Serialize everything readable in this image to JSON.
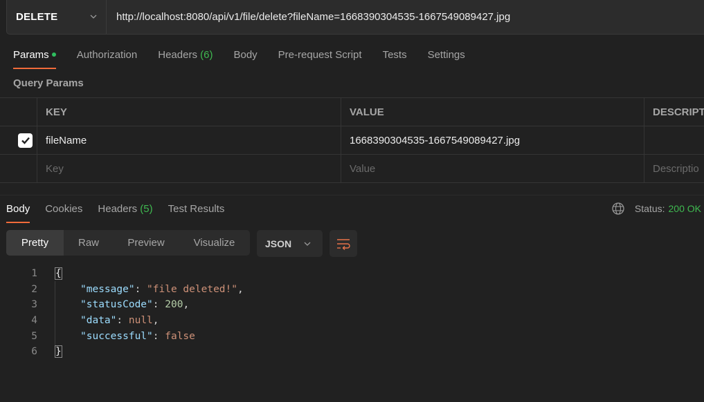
{
  "request": {
    "method": "DELETE",
    "url": "http://localhost:8080/api/v1/file/delete?fileName=1668390304535-1667549089427.jpg"
  },
  "request_tabs": [
    {
      "label": "Params",
      "active": true,
      "dot": true
    },
    {
      "label": "Authorization"
    },
    {
      "label": "Headers",
      "count": "(6)"
    },
    {
      "label": "Body"
    },
    {
      "label": "Pre-request Script"
    },
    {
      "label": "Tests"
    },
    {
      "label": "Settings"
    }
  ],
  "query_params": {
    "section_label": "Query Params",
    "columns": [
      "KEY",
      "VALUE",
      "DESCRIPTI"
    ],
    "rows": [
      {
        "checked": true,
        "key": "fileName",
        "value": "1668390304535-1667549089427.jpg",
        "description": ""
      }
    ],
    "placeholders": {
      "key": "Key",
      "value": "Value",
      "description": "Descriptio"
    }
  },
  "response_tabs": [
    {
      "label": "Body",
      "active": true
    },
    {
      "label": "Cookies"
    },
    {
      "label": "Headers",
      "count": "(5)"
    },
    {
      "label": "Test Results"
    }
  ],
  "status": {
    "label": "Status:",
    "value": "200 OK",
    "icon": "globe-icon"
  },
  "view_modes": [
    {
      "label": "Pretty",
      "active": true
    },
    {
      "label": "Raw"
    },
    {
      "label": "Preview"
    },
    {
      "label": "Visualize"
    }
  ],
  "format": "JSON",
  "wrap_icon": "wrap-lines-icon",
  "response_body": {
    "line_numbers": [
      "1",
      "2",
      "3",
      "4",
      "5",
      "6"
    ],
    "open_brace": "{",
    "close_brace": "}",
    "fields": [
      {
        "key": "\"message\"",
        "value": "\"file deleted!\"",
        "type": "string",
        "comma": ","
      },
      {
        "key": "\"statusCode\"",
        "value": "200",
        "type": "number",
        "comma": ","
      },
      {
        "key": "\"data\"",
        "value": "null",
        "type": "keyword",
        "comma": ","
      },
      {
        "key": "\"successful\"",
        "value": "false",
        "type": "keyword",
        "comma": ""
      }
    ]
  }
}
